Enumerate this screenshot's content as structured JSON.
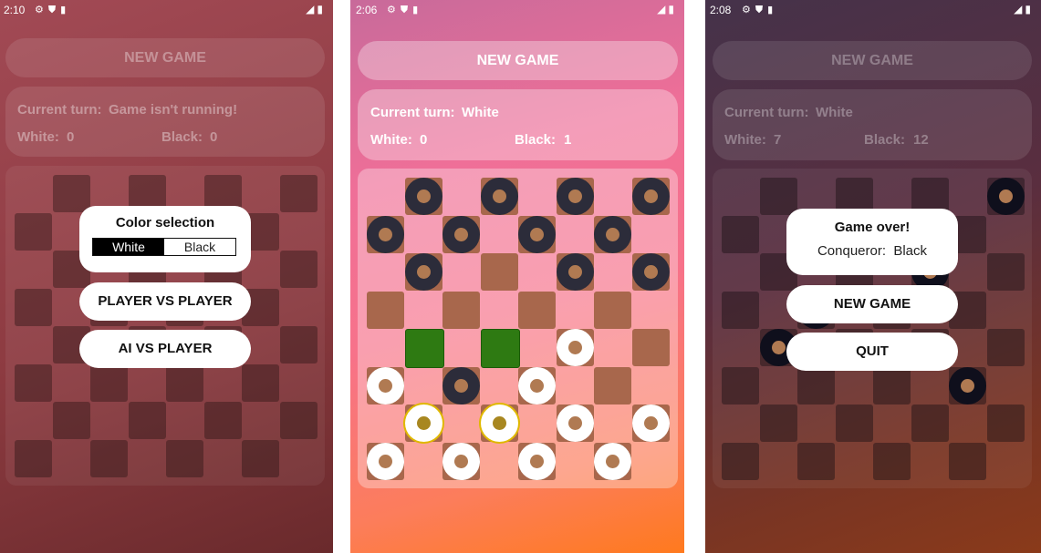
{
  "screens": [
    {
      "status": {
        "time": "2:10"
      },
      "new_game_label": "NEW GAME",
      "turn_label": "Current turn:",
      "turn_value": "Game isn't running!",
      "white_label": "White:",
      "white_score": "0",
      "black_label": "Black:",
      "black_score": "0",
      "dialog": {
        "title": "Color selection",
        "options": [
          "White",
          "Black"
        ],
        "selected": "White",
        "buttons": [
          "PLAYER VS PLAYER",
          "AI VS PLAYER"
        ]
      }
    },
    {
      "status": {
        "time": "2:06"
      },
      "new_game_label": "NEW GAME",
      "turn_label": "Current turn:",
      "turn_value": "White",
      "white_label": "White:",
      "white_score": "0",
      "black_label": "Black:",
      "black_score": "1"
    },
    {
      "status": {
        "time": "2:08"
      },
      "new_game_label": "NEW GAME",
      "turn_label": "Current turn:",
      "turn_value": "White",
      "white_label": "White:",
      "white_score": "7",
      "black_label": "Black:",
      "black_score": "12",
      "dialog": {
        "title": "Game over!",
        "conqueror_label": "Conqueror:",
        "conqueror_value": "Black",
        "buttons": [
          "NEW GAME",
          "QUIT"
        ]
      }
    }
  ],
  "boards": {
    "screen2": {
      "pieces": [
        {
          "row": 0,
          "col": 1,
          "color": "black"
        },
        {
          "row": 0,
          "col": 3,
          "color": "black"
        },
        {
          "row": 0,
          "col": 5,
          "color": "black"
        },
        {
          "row": 0,
          "col": 7,
          "color": "black"
        },
        {
          "row": 1,
          "col": 0,
          "color": "black"
        },
        {
          "row": 1,
          "col": 2,
          "color": "black"
        },
        {
          "row": 1,
          "col": 4,
          "color": "black"
        },
        {
          "row": 1,
          "col": 6,
          "color": "black"
        },
        {
          "row": 2,
          "col": 1,
          "color": "black"
        },
        {
          "row": 2,
          "col": 5,
          "color": "black"
        },
        {
          "row": 2,
          "col": 7,
          "color": "black"
        },
        {
          "row": 4,
          "col": 5,
          "color": "white"
        },
        {
          "row": 5,
          "col": 0,
          "color": "white"
        },
        {
          "row": 5,
          "col": 2,
          "color": "black"
        },
        {
          "row": 5,
          "col": 4,
          "color": "white"
        },
        {
          "row": 6,
          "col": 1,
          "color": "white",
          "selected": true
        },
        {
          "row": 6,
          "col": 3,
          "color": "white",
          "selected": true
        },
        {
          "row": 6,
          "col": 5,
          "color": "white"
        },
        {
          "row": 6,
          "col": 7,
          "color": "white"
        },
        {
          "row": 7,
          "col": 0,
          "color": "white"
        },
        {
          "row": 7,
          "col": 2,
          "color": "white"
        },
        {
          "row": 7,
          "col": 4,
          "color": "white"
        },
        {
          "row": 7,
          "col": 6,
          "color": "white"
        }
      ],
      "highlighted": [
        {
          "row": 4,
          "col": 1
        },
        {
          "row": 4,
          "col": 3
        }
      ]
    },
    "screen3": {
      "pieces": [
        {
          "row": 0,
          "col": 7,
          "color": "black"
        },
        {
          "row": 2,
          "col": 5,
          "color": "black"
        },
        {
          "row": 3,
          "col": 2,
          "color": "black"
        },
        {
          "row": 4,
          "col": 1,
          "color": "black"
        },
        {
          "row": 5,
          "col": 6,
          "color": "black"
        }
      ]
    }
  },
  "colors": {
    "dark_square_p2": "#a8674c",
    "highlight_square": "#2e7a12",
    "selected_piece_ring": "#e0b800"
  }
}
